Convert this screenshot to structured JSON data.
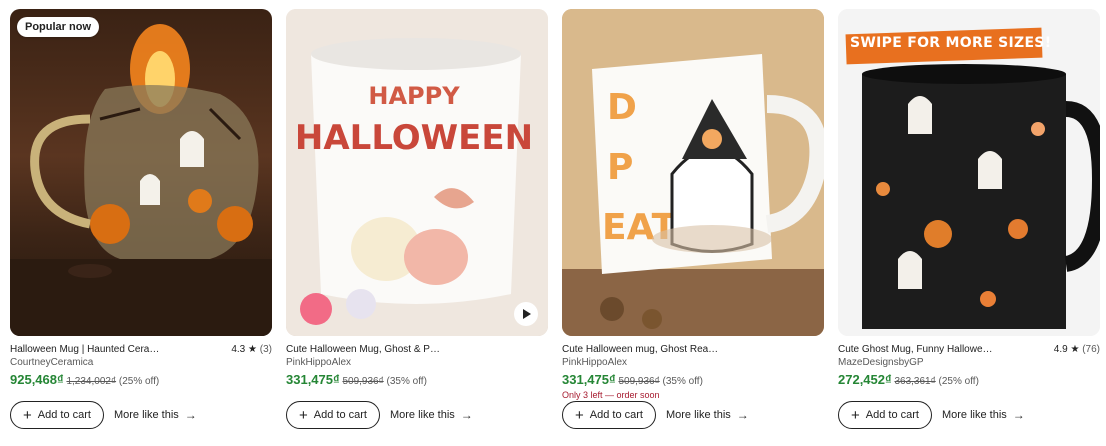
{
  "colors": {
    "price_green": "#258635",
    "stock_red": "#a61a2e"
  },
  "icons": {
    "plus": "plus-icon",
    "arrow": "arrow-right-icon",
    "star": "star-icon",
    "play": "play-icon"
  },
  "products": [
    {
      "badge": "Popular now",
      "title": "Halloween Mug | Haunted Cera…",
      "rating": "4.3",
      "star": "★",
      "reviews": "(3)",
      "shop": "CourtneyCeramica",
      "price": "925,468₫",
      "original_price": "1,234,002₫",
      "discount": "(25% off)",
      "add_to_cart": "Add to cart",
      "more_like_this": "More like this"
    },
    {
      "title": "Cute Halloween Mug, Ghost & P…",
      "shop": "PinkHippoAlex",
      "price": "331,475₫",
      "original_price": "509,936₫",
      "discount": "(35% off)",
      "mug_text_1": "HAPPY",
      "mug_text_2": "HALLOWEEN",
      "add_to_cart": "Add to cart",
      "more_like_this": "More like this"
    },
    {
      "title": "Cute Halloween mug, Ghost Rea…",
      "shop": "PinkHippoAlex",
      "price": "331,475₫",
      "original_price": "509,936₫",
      "discount": "(35% off)",
      "stock_note": "Only 3 left — order soon",
      "mug_text": "D P EAT",
      "add_to_cart": "Add to cart",
      "more_like_this": "More like this"
    },
    {
      "banner": "SWIPE FOR MORE SIZES!",
      "title": "Cute Ghost Mug, Funny Hallowe…",
      "rating": "4.9",
      "star": "★",
      "reviews": "(76)",
      "shop": "MazeDesignsbyGP",
      "price": "272,452₫",
      "original_price": "363,361₫",
      "discount": "(25% off)",
      "add_to_cart": "Add to cart",
      "more_like_this": "More like this"
    }
  ]
}
